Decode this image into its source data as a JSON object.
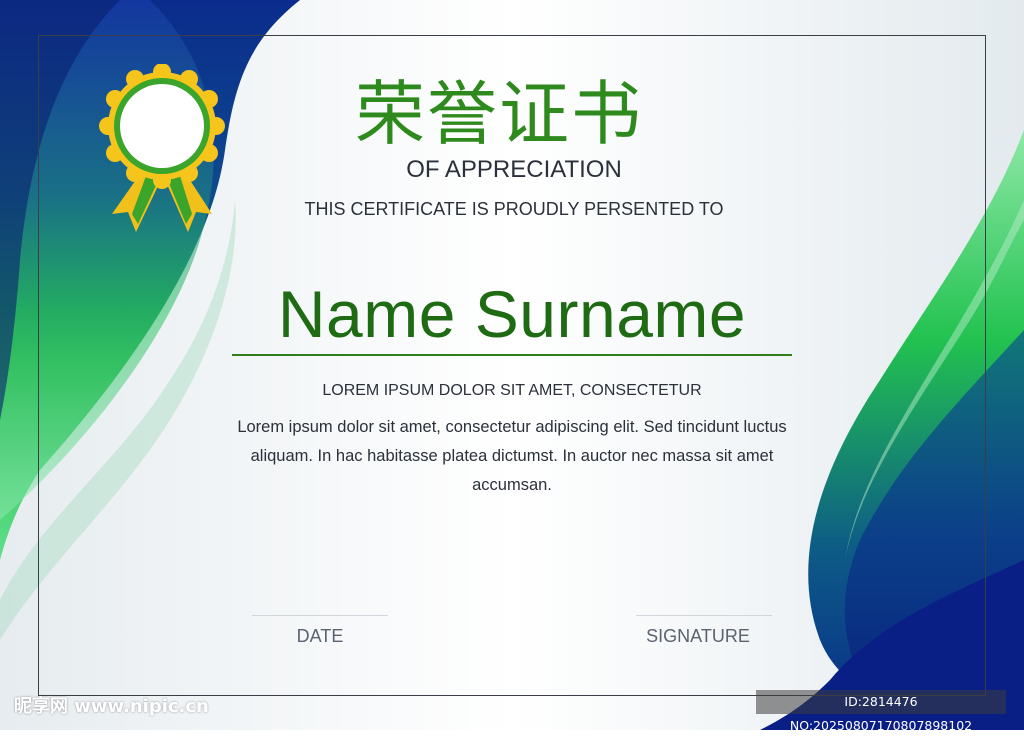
{
  "certificate": {
    "title_cn": "荣誉证书",
    "subtitle": "OF APPRECIATION",
    "presented_line": "THIS CERTIFICATE IS PROUDLY PERSENTED TO",
    "recipient_name": "Name Surname",
    "body_heading": "LOREM IPSUM DOLOR SIT AMET, CONSECTETUR",
    "body_text": "Lorem ipsum dolor sit amet, consectetur adipiscing elit. Sed tincidunt luctus aliquam. In hac habitasse platea dictumst. In auctor nec massa sit amet accumsan.",
    "date_label": "DATE",
    "signature_label": "SIGNATURE"
  },
  "badge": {
    "icon": "award-rosette-icon",
    "color_gold": "#f5c51c",
    "color_green": "#3aa52a"
  },
  "colors": {
    "accent_green": "#2f8a1e",
    "name_green": "#1f6b13",
    "wave_navy": "#0d2a8a",
    "wave_green": "#29c45a"
  },
  "watermark": {
    "left_text": "昵享网 www.nipic.cn",
    "right_text": "ID:2814476 NO:20250807170807898102"
  }
}
